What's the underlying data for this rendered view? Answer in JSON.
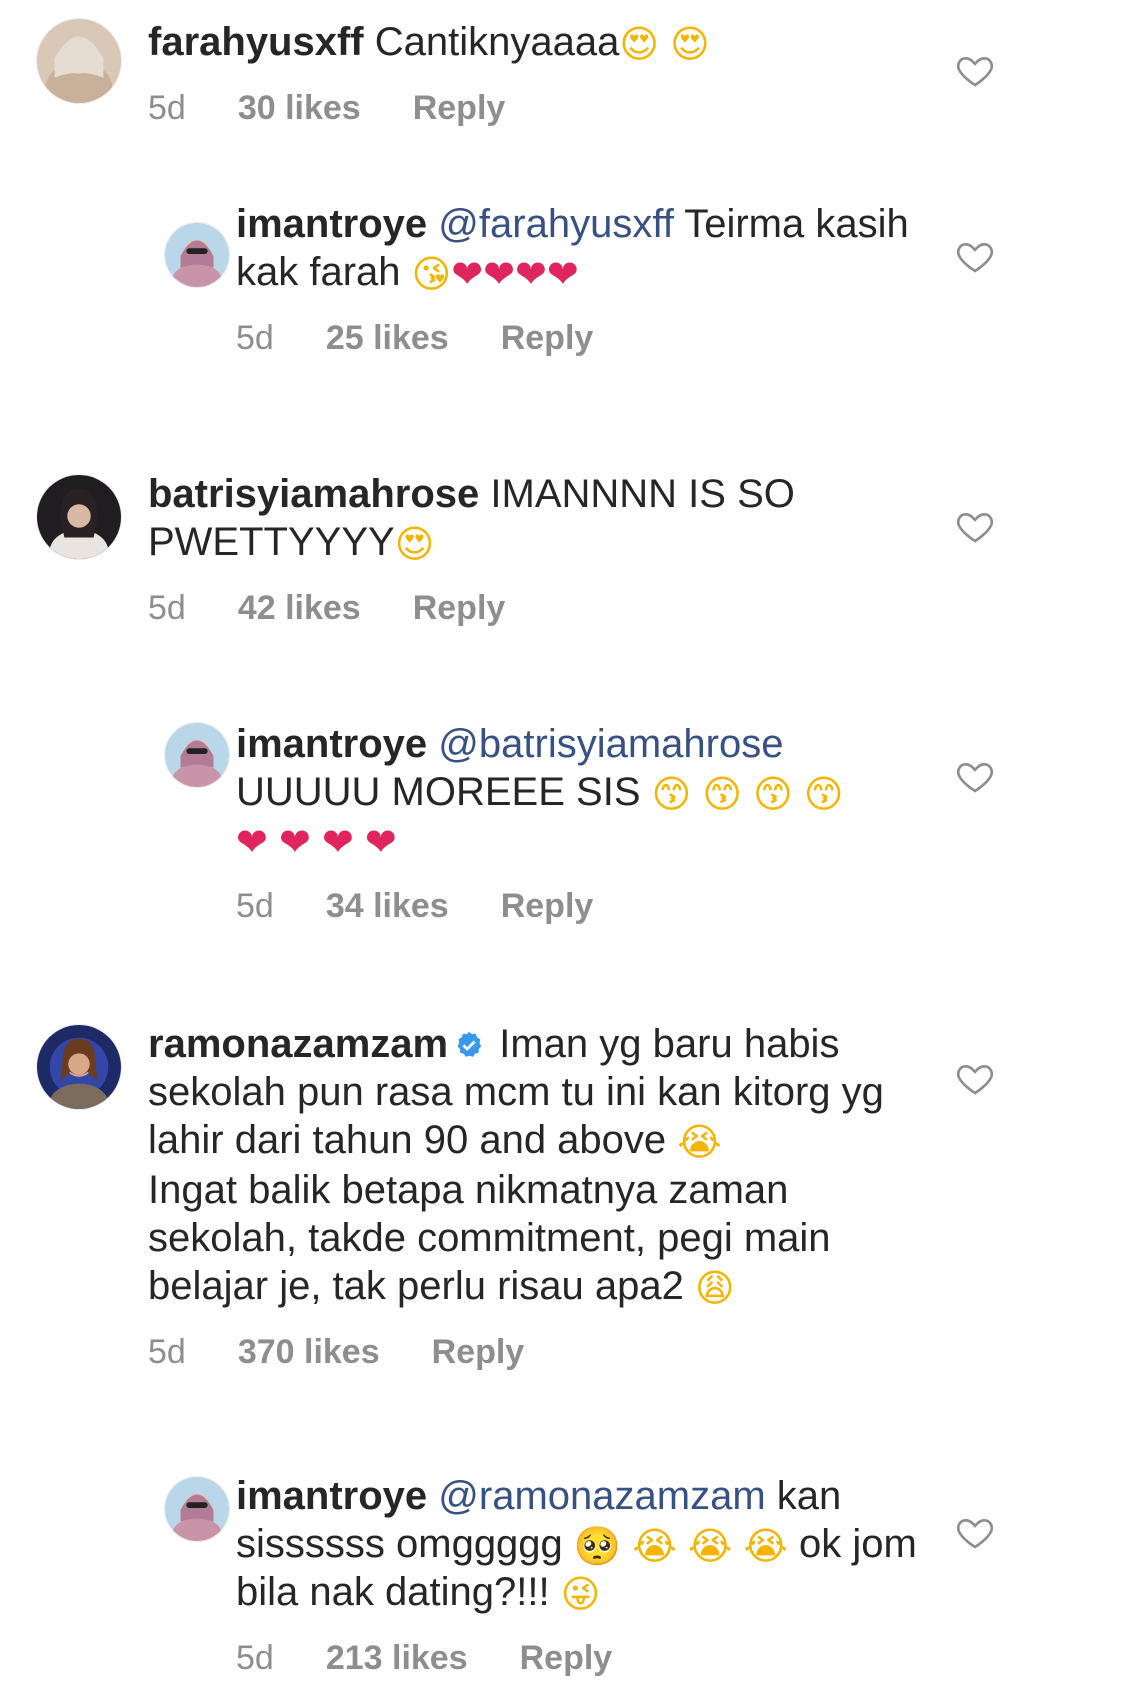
{
  "comments": [
    {
      "username": "farahyusxff",
      "text_parts": [
        "Cantiknyaaaa",
        "😍",
        "😍"
      ],
      "time": "5d",
      "likes": "30 likes",
      "reply": "Reply"
    },
    {
      "username": "imantroye",
      "mention": "@farahyusxff",
      "text_parts": [
        "Teirma kasih kak farah",
        "😘",
        "❤",
        "❤",
        "❤",
        "❤"
      ],
      "time": "5d",
      "likes": "25 likes",
      "reply": "Reply"
    },
    {
      "username": "batrisyiamahrose",
      "text_parts": [
        "IMANNNN IS SO PWETTYYYY",
        "😍"
      ],
      "time": "5d",
      "likes": "42 likes",
      "reply": "Reply"
    },
    {
      "username": "imantroye",
      "mention": "@batrisyiamahrose",
      "text_parts": [
        "UUUUU MOREEE SIS",
        "😙",
        "😙",
        "😙",
        "😙",
        "❤",
        "❤",
        "❤",
        "❤"
      ],
      "time": "5d",
      "likes": "34 likes",
      "reply": "Reply"
    },
    {
      "username": "ramonazamzam",
      "verified": true,
      "text_parts": [
        "Iman yg baru habis sekolah pun rasa mcm tu ini kan kitorg yg lahir dari tahun 90 and above",
        "😭",
        "Ingat balik betapa nikmatnya zaman sekolah, takde commitment, pegi main belajar je, tak perlu risau apa2",
        "😩"
      ],
      "time": "5d",
      "likes": "370 likes",
      "reply": "Reply"
    },
    {
      "username": "imantroye",
      "mention": "@ramonazamzam",
      "text_parts": [
        "kan sissssss omggggg",
        "🥺",
        "😭",
        "😭",
        "😭",
        "ok jom bila nak dating?!!!",
        "😜"
      ],
      "time": "5d",
      "likes": "213 likes",
      "reply": "Reply"
    }
  ],
  "icons": {
    "like": "heart-outline-icon",
    "verified": "verified-badge-icon"
  },
  "colors": {
    "text": "#262626",
    "meta": "#8e8e8e",
    "mention": "#385185",
    "verified": "#3897f0"
  }
}
